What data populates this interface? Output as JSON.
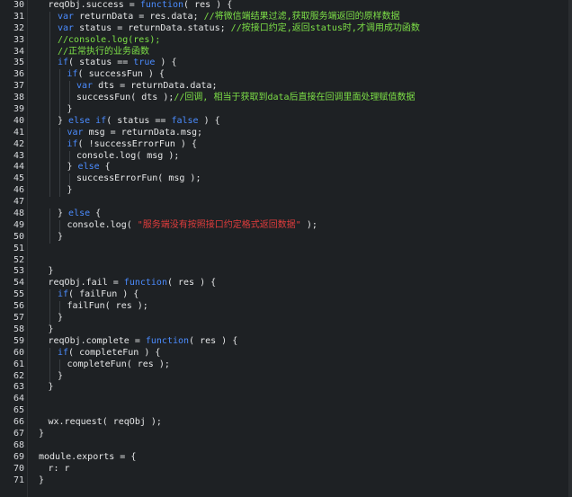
{
  "theme": {
    "background": "#1e2124",
    "keyword": "#4b8cff",
    "comment": "#7de047",
    "string": "#e03c3c",
    "text": "#e6e7e8"
  },
  "lines": [
    {
      "n": "30",
      "i": 1,
      "t": [
        [
          "reqObj.success = ",
          "pl"
        ],
        [
          "function",
          "kw"
        ],
        [
          "( res ) {",
          "pl"
        ]
      ]
    },
    {
      "n": "31",
      "i": 2,
      "t": [
        [
          "var",
          "kw"
        ],
        [
          " returnData = res.data; ",
          "pl"
        ],
        [
          "//将微信端结果过滤,获取服务端返回的原样数据",
          "cm"
        ]
      ]
    },
    {
      "n": "32",
      "i": 2,
      "t": [
        [
          "var",
          "kw"
        ],
        [
          " status = returnData.status; ",
          "pl"
        ],
        [
          "//按接口约定,返回status时,才调用成功函数",
          "cm"
        ]
      ]
    },
    {
      "n": "33",
      "i": 2,
      "t": [
        [
          "//console.log(res);",
          "cm"
        ]
      ]
    },
    {
      "n": "34",
      "i": 2,
      "t": [
        [
          "//正常执行的业务函数",
          "cm"
        ]
      ]
    },
    {
      "n": "35",
      "i": 2,
      "t": [
        [
          "if",
          "kw"
        ],
        [
          "( status == ",
          "pl"
        ],
        [
          "true",
          "kw"
        ],
        [
          " ) {",
          "pl"
        ]
      ]
    },
    {
      "n": "36",
      "i": 3,
      "t": [
        [
          "if",
          "kw"
        ],
        [
          "( successFun ) {",
          "pl"
        ]
      ]
    },
    {
      "n": "37",
      "i": 4,
      "t": [
        [
          "var",
          "kw"
        ],
        [
          " dts = returnData.data;",
          "pl"
        ]
      ]
    },
    {
      "n": "38",
      "i": 4,
      "t": [
        [
          "successFun( dts );",
          "pl"
        ],
        [
          "//回调, 相当于获取到data后直接在回调里面处理赋值数据",
          "cm"
        ]
      ]
    },
    {
      "n": "39",
      "i": 3,
      "t": [
        [
          "}",
          "pl"
        ]
      ]
    },
    {
      "n": "40",
      "i": 2,
      "t": [
        [
          "} ",
          "pl"
        ],
        [
          "else if",
          "kw"
        ],
        [
          "( status == ",
          "pl"
        ],
        [
          "false",
          "kw"
        ],
        [
          " ) {",
          "pl"
        ]
      ]
    },
    {
      "n": "41",
      "i": 3,
      "t": [
        [
          "var",
          "kw"
        ],
        [
          " msg = returnData.msg;",
          "pl"
        ]
      ]
    },
    {
      "n": "42",
      "i": 3,
      "t": [
        [
          "if",
          "kw"
        ],
        [
          "( !successErrorFun ) {",
          "pl"
        ]
      ]
    },
    {
      "n": "43",
      "i": 4,
      "t": [
        [
          "console.log( msg );",
          "pl"
        ]
      ]
    },
    {
      "n": "44",
      "i": 3,
      "t": [
        [
          "} ",
          "pl"
        ],
        [
          "else",
          "kw"
        ],
        [
          " {",
          "pl"
        ]
      ]
    },
    {
      "n": "45",
      "i": 4,
      "t": [
        [
          "successErrorFun( msg );",
          "pl"
        ]
      ]
    },
    {
      "n": "46",
      "i": 3,
      "t": [
        [
          "}",
          "pl"
        ]
      ]
    },
    {
      "n": "47",
      "i": 0,
      "t": []
    },
    {
      "n": "48",
      "i": 2,
      "t": [
        [
          "} ",
          "pl"
        ],
        [
          "else",
          "kw"
        ],
        [
          " {",
          "pl"
        ]
      ]
    },
    {
      "n": "49",
      "i": 3,
      "t": [
        [
          "console.log( ",
          "pl"
        ],
        [
          "\"服务端没有按照接口约定格式返回数据\"",
          "str"
        ],
        [
          " );",
          "pl"
        ]
      ]
    },
    {
      "n": "50",
      "i": 2,
      "t": [
        [
          "}",
          "pl"
        ]
      ]
    },
    {
      "n": "51",
      "i": 0,
      "t": []
    },
    {
      "n": "52",
      "i": 0,
      "t": []
    },
    {
      "n": "53",
      "i": 1,
      "t": [
        [
          "}",
          "pl"
        ]
      ]
    },
    {
      "n": "54",
      "i": 1,
      "t": [
        [
          "reqObj.fail = ",
          "pl"
        ],
        [
          "function",
          "kw"
        ],
        [
          "( res ) {",
          "pl"
        ]
      ]
    },
    {
      "n": "55",
      "i": 2,
      "t": [
        [
          "if",
          "kw"
        ],
        [
          "( failFun ) {",
          "pl"
        ]
      ]
    },
    {
      "n": "56",
      "i": 3,
      "t": [
        [
          "failFun( res );",
          "pl"
        ]
      ]
    },
    {
      "n": "57",
      "i": 2,
      "t": [
        [
          "}",
          "pl"
        ]
      ]
    },
    {
      "n": "58",
      "i": 1,
      "t": [
        [
          "}",
          "pl"
        ]
      ]
    },
    {
      "n": "59",
      "i": 1,
      "t": [
        [
          "reqObj.complete = ",
          "pl"
        ],
        [
          "function",
          "kw"
        ],
        [
          "( res ) {",
          "pl"
        ]
      ]
    },
    {
      "n": "60",
      "i": 2,
      "t": [
        [
          "if",
          "kw"
        ],
        [
          "( completeFun ) {",
          "pl"
        ]
      ]
    },
    {
      "n": "61",
      "i": 3,
      "t": [
        [
          "completeFun( res );",
          "pl"
        ]
      ]
    },
    {
      "n": "62",
      "i": 2,
      "t": [
        [
          "}",
          "pl"
        ]
      ]
    },
    {
      "n": "63",
      "i": 1,
      "t": [
        [
          "}",
          "pl"
        ]
      ]
    },
    {
      "n": "64",
      "i": 0,
      "t": []
    },
    {
      "n": "65",
      "i": 0,
      "t": []
    },
    {
      "n": "66",
      "i": 1,
      "t": [
        [
          "wx.request( reqObj );",
          "pl"
        ]
      ]
    },
    {
      "n": "67",
      "i": 0,
      "t": [
        [
          "}",
          "pl"
        ]
      ]
    },
    {
      "n": "68",
      "i": 0,
      "t": []
    },
    {
      "n": "69",
      "i": 0,
      "t": [
        [
          "module.exports = {",
          "pl"
        ]
      ]
    },
    {
      "n": "70",
      "i": 1,
      "t": [
        [
          "r: r",
          "pl"
        ]
      ]
    },
    {
      "n": "71",
      "i": 0,
      "t": [
        [
          "}",
          "pl"
        ]
      ]
    }
  ]
}
